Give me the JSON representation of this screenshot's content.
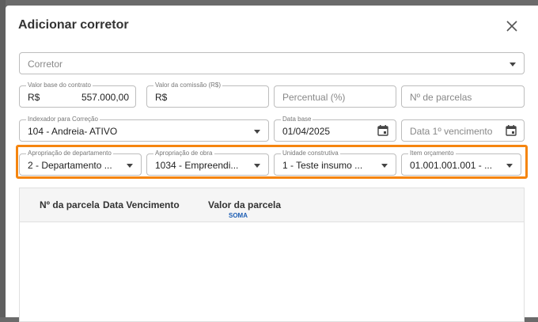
{
  "dialog": {
    "title": "Adicionar corretor"
  },
  "form": {
    "corretor": {
      "placeholder": "Corretor"
    },
    "valor_base": {
      "label": "Valor base do contrato",
      "prefix": "R$",
      "value": "557.000,00"
    },
    "valor_comissao": {
      "label": "Valor da comissão (R$)",
      "prefix": "R$"
    },
    "percentual": {
      "placeholder": "Percentual (%)"
    },
    "num_parcelas": {
      "placeholder": "Nº de parcelas"
    },
    "indexador": {
      "label": "Indexador para Correção",
      "value": "104 - Andreia- ATIVO"
    },
    "data_base": {
      "label": "Data base",
      "value": "01/04/2025"
    },
    "data_vencimento": {
      "placeholder": "Data 1º vencimento"
    },
    "apropriacao_departamento": {
      "label": "Apropriação de departamento",
      "value": "2 - Departamento ..."
    },
    "apropriacao_obra": {
      "label": "Apropriação de obra",
      "value": "1034 - Empreendi..."
    },
    "unidade_construtiva": {
      "label": "Unidade construtiva",
      "value": "1 - Teste insumo ..."
    },
    "item_orcamento": {
      "label": "Item orçamento",
      "value": "01.001.001.001 - ..."
    }
  },
  "table": {
    "columns": [
      "Nº da parcela",
      "Data Vencimento",
      "Valor da parcela"
    ],
    "soma_label": "SOMA"
  },
  "colors": {
    "highlight": "#f5850f",
    "soma": "#1e5fb4"
  }
}
